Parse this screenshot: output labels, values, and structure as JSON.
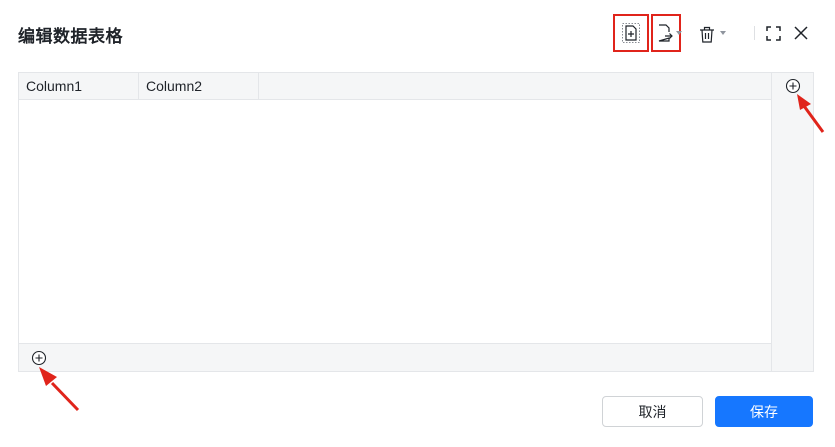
{
  "dialog": {
    "title": "编辑数据表格"
  },
  "toolbar": {
    "icons": [
      "import-file-icon",
      "export-file-icon",
      "trash-icon",
      "fullscreen-icon",
      "close-icon"
    ],
    "highlight_color": "#e0241b"
  },
  "table": {
    "columns": [
      "Column1",
      "Column2"
    ]
  },
  "footer": {
    "cancel_label": "取消",
    "save_label": "保存"
  },
  "colors": {
    "primary": "#1677ff",
    "annotation_arrow": "#e0241b"
  }
}
